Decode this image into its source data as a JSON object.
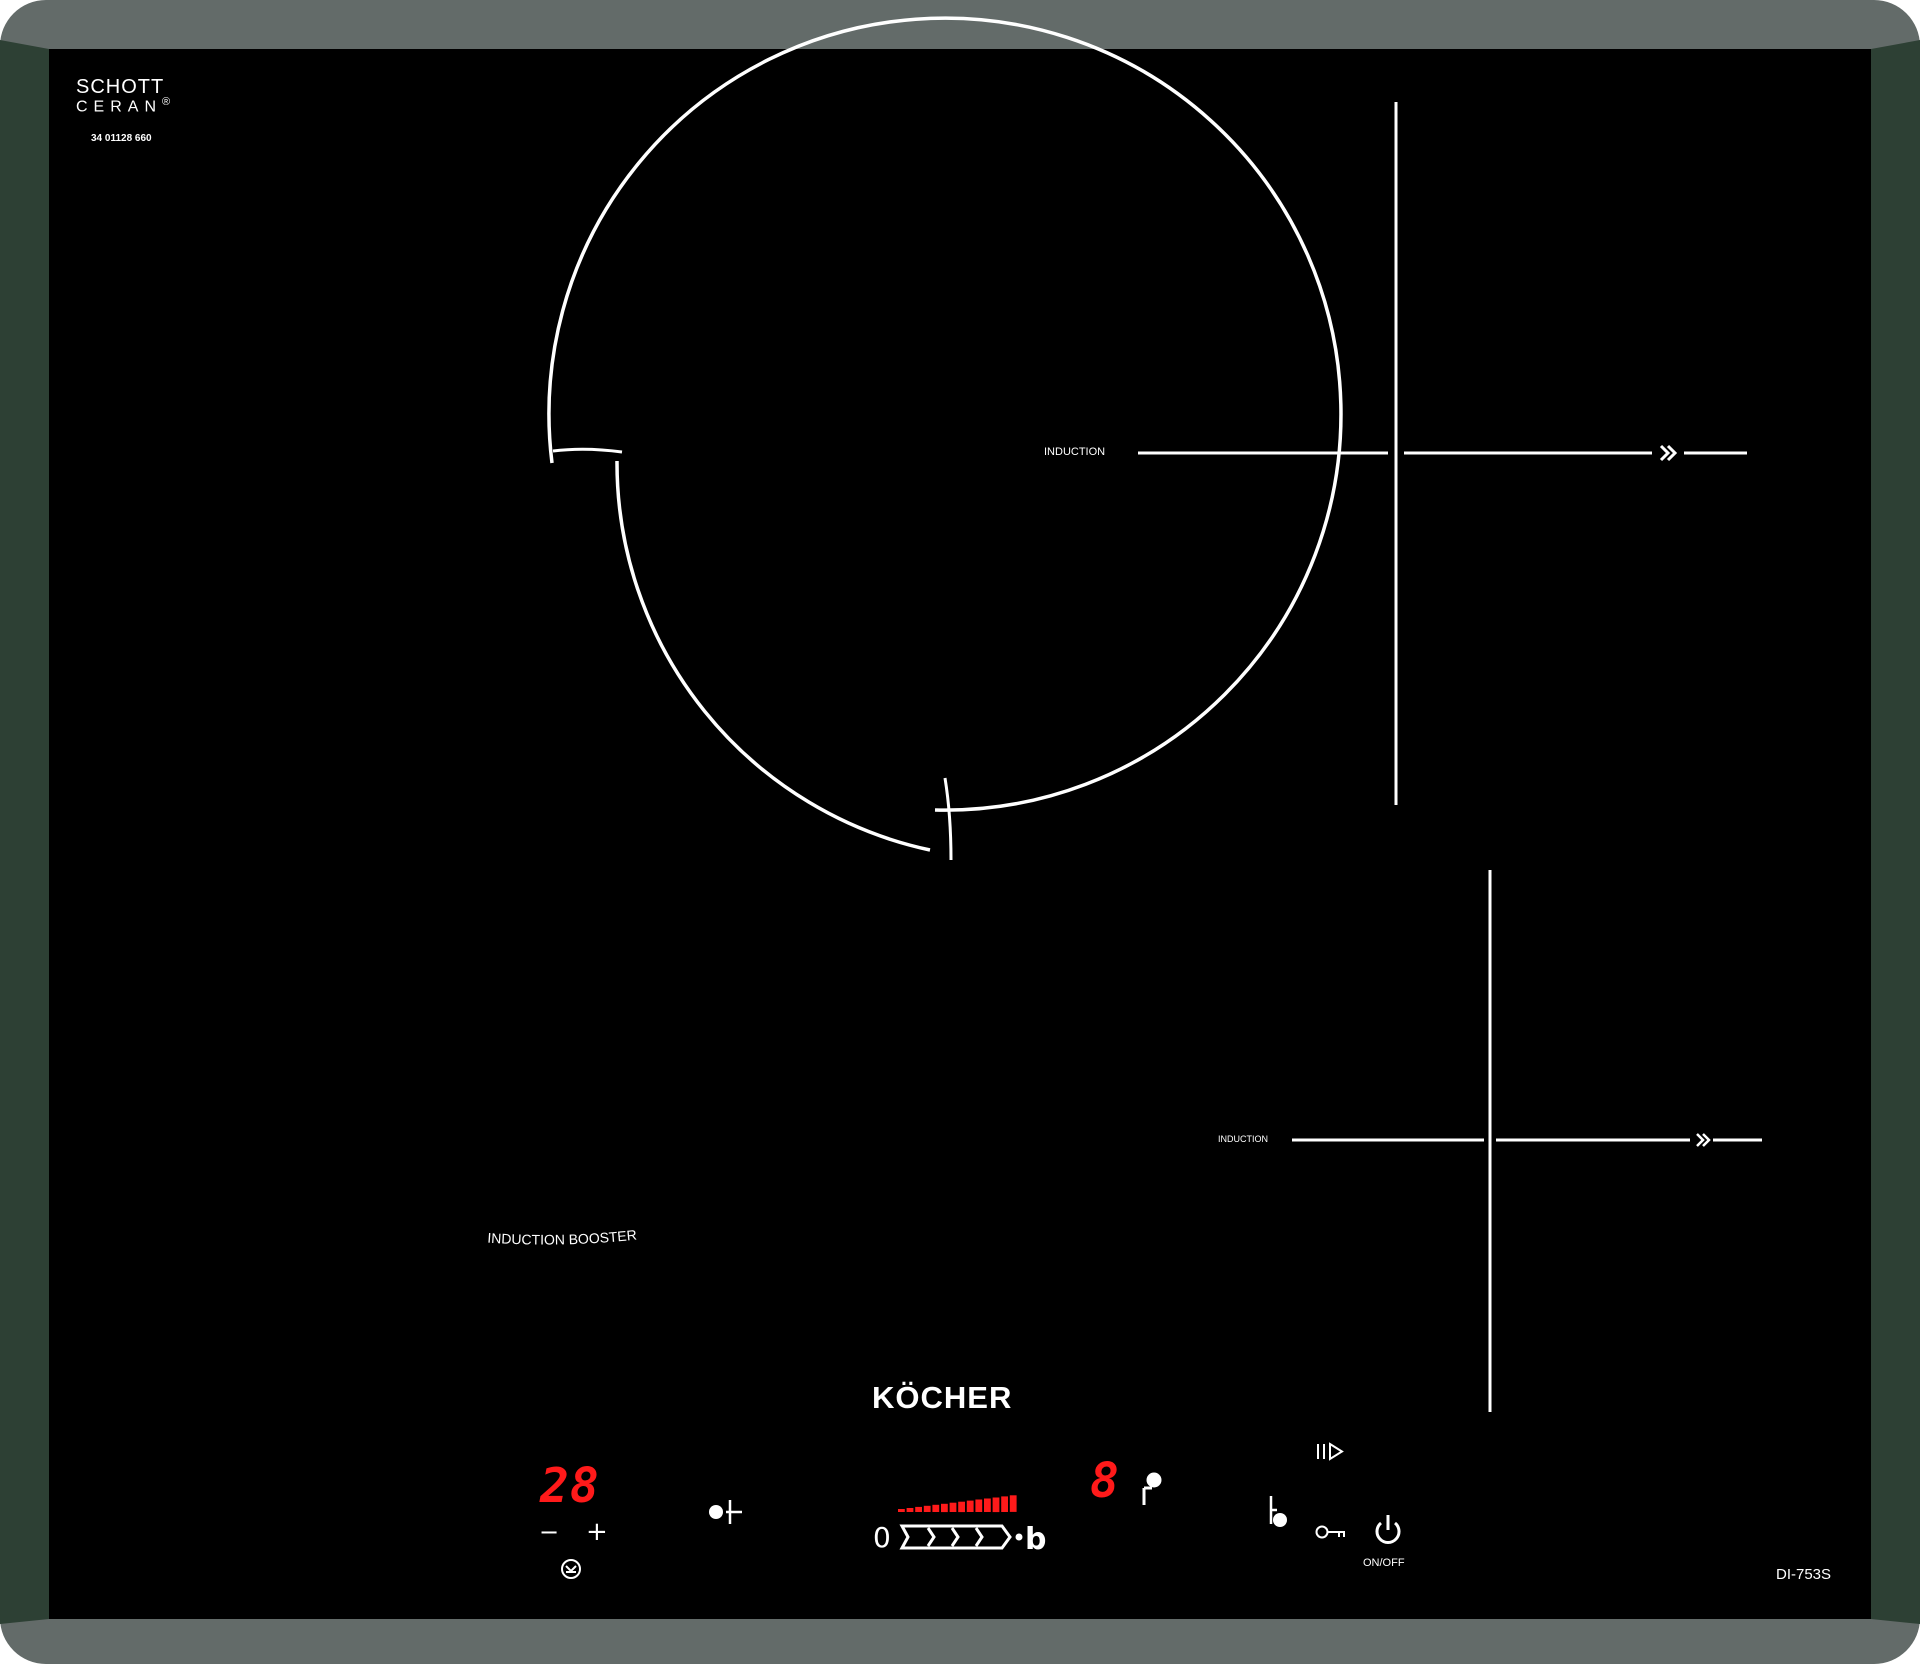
{
  "logo": {
    "line1": "SCHOTT",
    "line2": "CERAN",
    "reg_mark": "®"
  },
  "serial": "34 01128 660",
  "zones": {
    "large": {
      "label": "INDUCTION BOOSTER"
    },
    "top_right": {
      "label": "INDUCTION",
      "icon": "double-chevron-right-icon"
    },
    "bottom_right": {
      "label": "INDUCTION",
      "icon": "double-chevron-right-icon"
    }
  },
  "brand": "KÖCHER",
  "model": "DI-753S",
  "controls": {
    "timer_display": "28",
    "timer_minus": "−",
    "timer_plus": "+",
    "zone_select_icon": "zone-select-icon",
    "power_slider": {
      "min_label": "0",
      "max_label": "b",
      "level_fraction": 1.0
    },
    "power_level_display": "8",
    "pause_icon": "pause-play-icon",
    "keep_warm_icon": "keep-warm-icon",
    "lock_icon": "key-lock-icon",
    "power_icon": "power-icon",
    "on_off_label": "ON/OFF"
  },
  "colors": {
    "frame": "#636b69",
    "bezel_sides": "#2d4034",
    "glass": "#000000",
    "print": "#ffffff",
    "display_red": "#ff1a1a"
  }
}
